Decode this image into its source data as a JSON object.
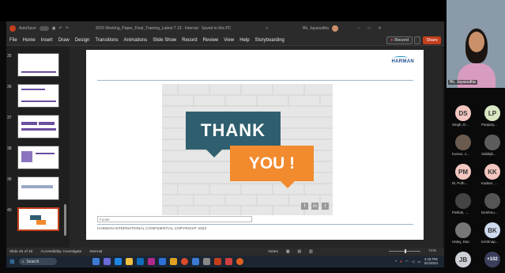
{
  "titlebar": {
    "autosave": "AutoSave",
    "filename": "3015 Working_Paper_Final_Training_Latest 7 13 · Internal · Saved to this PC",
    "user": "Bk, Jayasudha"
  },
  "ribbon": {
    "tabs": [
      "File",
      "Home",
      "Insert",
      "Draw",
      "Design",
      "Transitions",
      "Animations",
      "Slide Show",
      "Record",
      "Review",
      "View",
      "Help",
      "Storyboarding"
    ],
    "record": "Record",
    "share": "Share"
  },
  "thumbnails": [
    {
      "num": "35"
    },
    {
      "num": "36"
    },
    {
      "num": "37"
    },
    {
      "num": "38"
    },
    {
      "num": "39"
    },
    {
      "num": "40"
    }
  ],
  "slide": {
    "logo": "HARMAN",
    "thank": "THANK",
    "you": "YOU !",
    "footer_placeholder": "Footer",
    "confidential": "HARMAN INTERNATIONAL CONFIDENTIAL COPYRIGHT 2023",
    "social": [
      "f",
      "in",
      "t"
    ]
  },
  "status": {
    "slide_info": "Slide 40 of 40",
    "accessibility": "Accessibility: Investigate",
    "sensitivity": "Internal",
    "notes": "Notes",
    "zoom": "71%"
  },
  "taskbar": {
    "search": "Search",
    "time": "4:18 PM",
    "date": "3/1/2024"
  },
  "participants": {
    "self_name": "Bk, Jayasudha",
    "people": [
      {
        "initials": "DS",
        "name": "Singh, D...",
        "color": "#f3c6c0",
        "text": "#333"
      },
      {
        "initials": "LP",
        "name": "Panjany...",
        "color": "#d9e7c3",
        "text": "#333"
      },
      {
        "initials": "",
        "name": "Kumar, J...",
        "color": "#6b5a4e",
        "text": "#fff"
      },
      {
        "initials": "",
        "name": "Siddiqh...",
        "color": "#5c5c5c",
        "text": "#fff"
      },
      {
        "initials": "PM",
        "name": "M, Poth...",
        "color": "#f3c6c0",
        "text": "#333"
      },
      {
        "initials": "KK",
        "name": "Kadam, ...",
        "color": "#f3c6c0",
        "text": "#333"
      },
      {
        "initials": "",
        "name": "Pathak, ...",
        "color": "#444",
        "text": "#fff"
      },
      {
        "initials": "",
        "name": "Deshmu...",
        "color": "#555",
        "text": "#fff"
      },
      {
        "initials": "",
        "name": "Haley, Dan",
        "color": "#777",
        "text": "#fff"
      },
      {
        "initials": "BK",
        "name": "Krishnap...",
        "color": "#cdd9ee",
        "text": "#333"
      },
      {
        "initials": "JB",
        "name": "",
        "color": "#cdd0d6",
        "text": "#333"
      },
      {
        "initials": "+102",
        "name": "",
        "color": "#3a3f5c",
        "text": "#fff"
      }
    ]
  }
}
